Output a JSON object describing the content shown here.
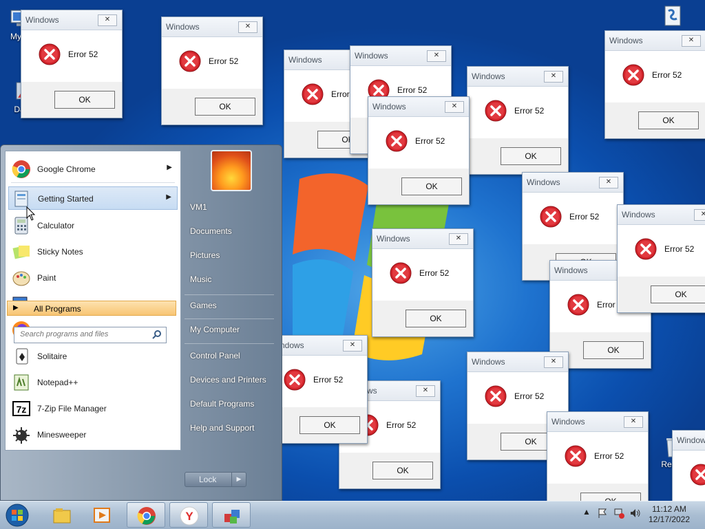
{
  "desktop": {
    "icons": [
      {
        "label": "My C"
      },
      {
        "label": "Data"
      },
      {
        "label": "Recyc"
      }
    ]
  },
  "dialog": {
    "title": "Windows",
    "message": "Error 52",
    "ok_label": "OK",
    "close_glyph": "✕"
  },
  "start_menu": {
    "programs": [
      {
        "label": "Google Chrome",
        "icon": "chrome-icon",
        "has_arrow": true
      },
      {
        "label": "Getting Started",
        "icon": "getting-started-icon",
        "has_arrow": true
      },
      {
        "label": "Calculator",
        "icon": "calculator-icon"
      },
      {
        "label": "Sticky Notes",
        "icon": "sticky-notes-icon"
      },
      {
        "label": "Paint",
        "icon": "paint-icon"
      },
      {
        "label": "Magnifier",
        "icon": "magnifier-icon"
      },
      {
        "label": "Firefox",
        "icon": "firefox-icon"
      },
      {
        "label": "Solitaire",
        "icon": "solitaire-icon"
      },
      {
        "label": "Notepad++",
        "icon": "notepadpp-icon"
      },
      {
        "label": "7-Zip File Manager",
        "icon": "7zip-icon"
      },
      {
        "label": "Minesweeper",
        "icon": "minesweeper-icon"
      }
    ],
    "all_programs": "All Programs",
    "search_placeholder": "Search programs and files",
    "right_items": [
      "VM1",
      "Documents",
      "Pictures",
      "Music",
      "Games",
      "My Computer",
      "Control Panel",
      "Devices and Printers",
      "Default Programs",
      "Help and Support"
    ],
    "lock_label": "Lock"
  },
  "taskbar": {
    "buttons": [
      "start-orb",
      "explorer-icon",
      "media-player-icon",
      "chrome-icon",
      "yandex-icon",
      "app-icon"
    ],
    "clock_time": "11:12 AM",
    "clock_date": "12/17/2022"
  },
  "colors": {
    "desktop_blue": "#1f73cf",
    "error_red": "#d2242b",
    "highlight_orange": "#f8c573"
  }
}
